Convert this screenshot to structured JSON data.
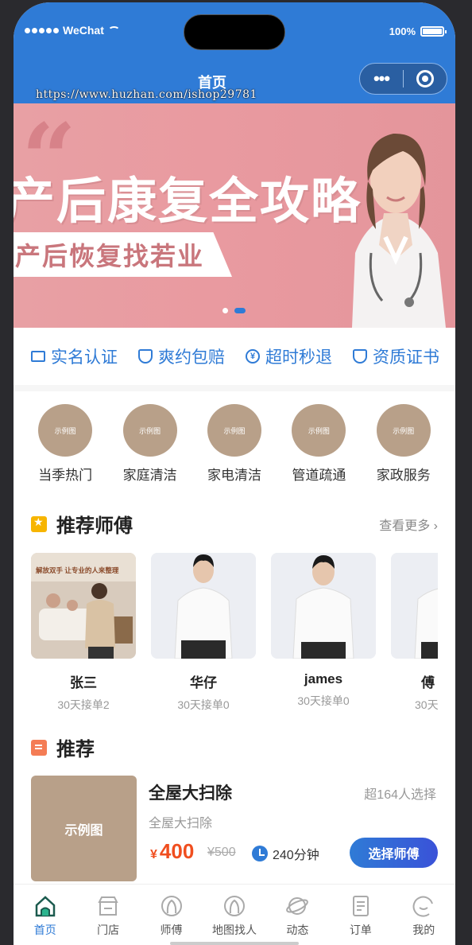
{
  "status_bar": {
    "carrier": "WeChat",
    "battery": "100%"
  },
  "nav": {
    "title": "首页",
    "watermark": "https://www.huzhan.com/ishop29781"
  },
  "banner": {
    "title": "产后康复全攻略",
    "subtitle": "产后恢复找若业",
    "slides": 2,
    "active_slide": 2
  },
  "guarantees": [
    {
      "icon": "id-card-icon",
      "label": "实名认证"
    },
    {
      "icon": "shield-icon",
      "label": "爽约包赔"
    },
    {
      "icon": "yen-icon",
      "label": "超时秒退"
    },
    {
      "icon": "shield-check-icon",
      "label": "资质证书"
    }
  ],
  "categories": [
    {
      "placeholder": "示例图",
      "label": "当季热门"
    },
    {
      "placeholder": "示例图",
      "label": "家庭清洁"
    },
    {
      "placeholder": "示例图",
      "label": "家电清洁"
    },
    {
      "placeholder": "示例图",
      "label": "管道疏通"
    },
    {
      "placeholder": "示例图",
      "label": "家政服务"
    }
  ],
  "recommended_masters": {
    "title": "推荐师傅",
    "more": "查看更多",
    "items": [
      {
        "name": "张三",
        "orders": "30天接单2",
        "poster_text": "解放双手 让专业的人来整理"
      },
      {
        "name": "华仔",
        "orders": "30天接单0"
      },
      {
        "name": "james",
        "orders": "30天接单0"
      },
      {
        "name": "傅",
        "orders": "30天"
      }
    ]
  },
  "recommend": {
    "title": "推荐",
    "product": {
      "image_placeholder": "示例图",
      "title": "全屋大扫除",
      "chosen": "超164人选择",
      "subtitle": "全屋大扫除",
      "currency": "¥",
      "price": "400",
      "original_price": "¥500",
      "duration": "240分钟",
      "button": "选择师傅"
    }
  },
  "tabbar": [
    {
      "icon": "home-icon",
      "label": "首页",
      "active": true
    },
    {
      "icon": "store-icon",
      "label": "门店"
    },
    {
      "icon": "master-icon",
      "label": "师傅"
    },
    {
      "icon": "map-person-icon",
      "label": "地图找人"
    },
    {
      "icon": "planet-icon",
      "label": "动态"
    },
    {
      "icon": "order-icon",
      "label": "订单"
    },
    {
      "icon": "profile-icon",
      "label": "我的"
    }
  ],
  "colors": {
    "primary": "#2f7bd6",
    "price": "#f04e1f",
    "placeholder": "#b8a089"
  }
}
